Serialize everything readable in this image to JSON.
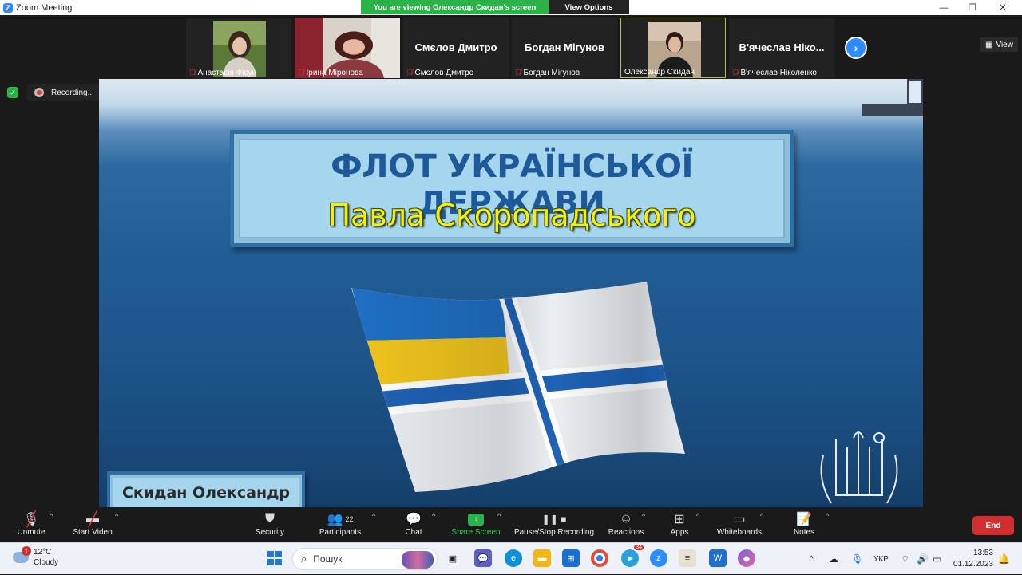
{
  "window": {
    "title": "Zoom Meeting"
  },
  "banner": {
    "viewing": "You are viewing Олександр Скидан's screen",
    "view_options": "View Options"
  },
  "view_button": "View",
  "participants": [
    {
      "name": "Анастасія Фісун",
      "muted": true,
      "type": "video"
    },
    {
      "name": "Ірина Міронова",
      "muted": true,
      "type": "video"
    },
    {
      "name": "Смєлов Дмитро",
      "display": "Смєлов Дмитро",
      "muted": true,
      "type": "name"
    },
    {
      "name": "Богдан Мігунов",
      "display": "Богдан Мігунов",
      "muted": true,
      "type": "name"
    },
    {
      "name": "Олександр Скидан",
      "muted": false,
      "type": "video",
      "active": true
    },
    {
      "name": "В'ячеслав Ніколенко",
      "display": "В'ячеслав  Ніко...",
      "muted": true,
      "type": "name"
    }
  ],
  "recording": {
    "label": "Recording..."
  },
  "slide": {
    "title_line1": "ФЛОТ УКРАЇНСЬКОЇ ДЕРЖАВИ",
    "title_line2": "Павла Скоропадського",
    "author": "Скидан Олександр"
  },
  "toolbar": {
    "unmute": "Unmute",
    "start_video": "Start Video",
    "security": "Security",
    "participants": "Participants",
    "participants_count": "22",
    "chat": "Chat",
    "share_screen": "Share Screen",
    "recording": "Pause/Stop Recording",
    "reactions": "Reactions",
    "apps": "Apps",
    "whiteboards": "Whiteboards",
    "notes": "Notes",
    "end": "End"
  },
  "taskbar": {
    "weather_temp": "12°C",
    "weather_desc": "Cloudy",
    "weather_badge": "1",
    "search_placeholder": "Пошук",
    "telegram_badge": "34",
    "language": "УКР",
    "time": "13:53",
    "date": "01.12.2023"
  },
  "colors": {
    "zoom_blue": "#2d8cff",
    "share_green": "#2bb34a",
    "end_red": "#d12f2f",
    "slide_blue": "#1e5a9a",
    "slide_yellow": "#f2ef12"
  }
}
